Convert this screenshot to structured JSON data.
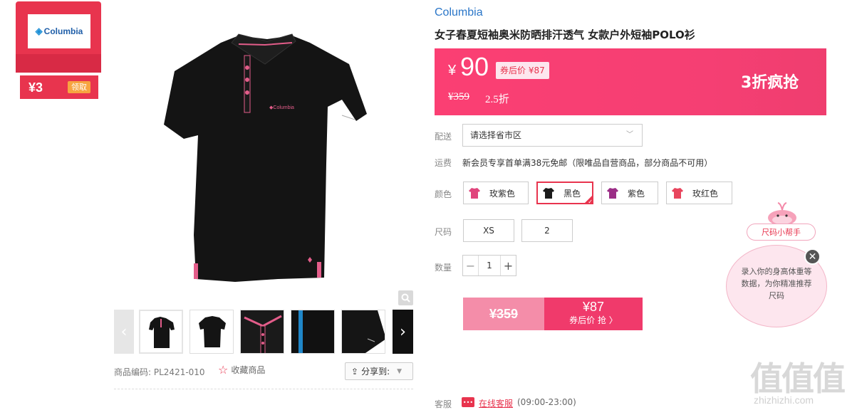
{
  "coupon": {
    "logo_text": "Columbia",
    "amount": "¥3",
    "claim_label": "领取"
  },
  "gallery": {
    "prev_icon": "‹",
    "next_icon": "›",
    "zoom_icon": "magnifier-icon",
    "product_code_label": "商品编码:",
    "product_code": "PL2421-010",
    "favorite_label": "收藏商品",
    "share_label": "分享到:"
  },
  "product": {
    "brand": "Columbia",
    "title": "女子春夏短袖奥米防晒排汗透气 女款户外短袖POLO衫"
  },
  "price": {
    "currency": "¥",
    "current": "90",
    "after_coupon": "券后价 ¥87",
    "original": "¥359",
    "discount": "2.5折",
    "promo": "3折疯抢"
  },
  "delivery": {
    "label": "配送",
    "select_placeholder": "请选择省市区"
  },
  "freight": {
    "label": "运费",
    "text": "新会员专享首单满38元免邮（限唯品自营商品，部分商品不可用）"
  },
  "colors": {
    "label": "颜色",
    "options": [
      {
        "name": "玫紫色",
        "color": "#e0457c"
      },
      {
        "name": "黑色",
        "color": "#1b1b1b"
      },
      {
        "name": "紫色",
        "color": "#9b2e86"
      },
      {
        "name": "玫红色",
        "color": "#e8455d"
      }
    ],
    "selected": "黑色"
  },
  "sizes": {
    "label": "尺码",
    "options": [
      "XS",
      "2"
    ]
  },
  "quantity": {
    "label": "数量",
    "value": "1",
    "minus": "−",
    "plus": "+"
  },
  "buy": {
    "original_price": "¥359",
    "coupon_price": "¥87",
    "coupon_action": "券后价 抢 〉"
  },
  "service": {
    "label": "客服",
    "link": "在线客服",
    "hours": "(09:00-23:00)"
  },
  "size_helper": {
    "title": "尺码小帮手",
    "text": "录入你的身高体重等数据，为你精准推荐尺码",
    "close": "✕"
  },
  "watermark": {
    "logo": "值值值",
    "site": "zhizhizhi.com"
  },
  "accent_color": "#e8344e"
}
